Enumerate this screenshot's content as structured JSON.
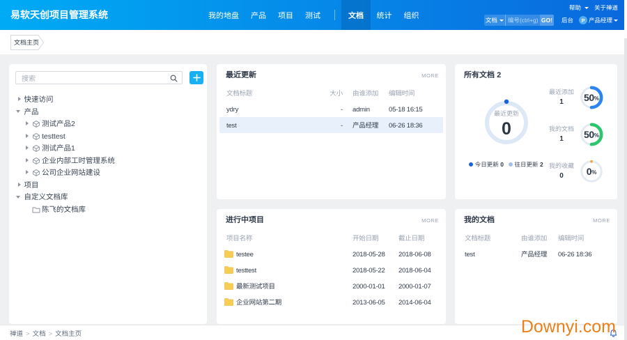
{
  "accent_colors": {
    "header_gradient_left": "#00abf5",
    "header_gradient_right": "#0a69dd",
    "highlight_row": "#e8f1fb",
    "watermark_color": "#e8811c"
  },
  "header": {
    "brand": "易软天创项目管理系统",
    "nav": [
      {
        "label": "我的地盘",
        "active": false
      },
      {
        "label": "产品",
        "active": false
      },
      {
        "label": "项目",
        "active": false
      },
      {
        "label": "测试",
        "active": false
      },
      {
        "label": "文档",
        "active": true
      },
      {
        "label": "统计",
        "active": false
      },
      {
        "label": "组织",
        "active": false
      }
    ],
    "help": "帮助",
    "about": "关于禅道",
    "search": {
      "module": "文档",
      "placeholder": "编号(ctrl+g)",
      "go": "GO!"
    },
    "admin": "后台",
    "avatar": "P",
    "user": "产品经理"
  },
  "tabs": [
    {
      "label": "文档主页",
      "active": true
    }
  ],
  "sidebar": {
    "search_placeholder": "搜索",
    "add_label": "+",
    "tree": [
      {
        "label": "快速访问",
        "state": "collapsed"
      },
      {
        "label": "产品",
        "state": "expanded"
      },
      {
        "label": "测试产品2",
        "parent": "产品",
        "icon": "product"
      },
      {
        "label": "testtest",
        "parent": "产品",
        "icon": "product"
      },
      {
        "label": "测试产品1",
        "parent": "产品",
        "icon": "product"
      },
      {
        "label": "企业内部工时管理系统",
        "parent": "产品",
        "icon": "product"
      },
      {
        "label": "公司企业网站建设",
        "parent": "产品",
        "icon": "product"
      },
      {
        "label": "项目",
        "state": "collapsed"
      },
      {
        "label": "自定义文档库",
        "state": "expanded"
      },
      {
        "label": "陈飞的文档库",
        "parent": "自定义文档库",
        "icon": "folder"
      }
    ]
  },
  "cards": {
    "recent": {
      "title": "最近更新",
      "more": "MORE",
      "columns": [
        "文档标题",
        "大小",
        "由谁添加",
        "编辑时间"
      ],
      "rows": [
        {
          "title": "ydry",
          "size": "-",
          "added_by": "admin",
          "edited": "05-18 16:15",
          "highlight": false
        },
        {
          "title": "test",
          "size": "-",
          "added_by": "产品经理",
          "edited": "06-26 18:36",
          "highlight": true
        }
      ]
    },
    "overview": {
      "title": "所有文档",
      "count": "2",
      "main_gauge": {
        "label": "最近更新",
        "value": "0"
      },
      "legend": [
        {
          "label": "今日更新",
          "value": "0",
          "color": "#1b62d6"
        },
        {
          "label": "往日更新",
          "value": "2",
          "color": "#a3c0ea"
        }
      ],
      "gauges": [
        {
          "label": "最近添加",
          "value": "1",
          "percent": 50,
          "unit": "%",
          "color": "#2b85ef"
        },
        {
          "label": "我的文档",
          "value": "1",
          "percent": 50,
          "unit": "%",
          "color": "#2bc56e"
        },
        {
          "label": "我的收藏",
          "value": "0",
          "percent": 0,
          "unit": "%",
          "color": "#f2a73d"
        }
      ]
    },
    "projects": {
      "title": "进行中项目",
      "more": "MORE",
      "columns": [
        "项目名称",
        "开始日期",
        "截止日期"
      ],
      "rows": [
        {
          "name": "testee",
          "begin": "2018-05-28",
          "end": "2018-06-08"
        },
        {
          "name": "testtest",
          "begin": "2018-05-22",
          "end": "2018-06-04"
        },
        {
          "name": "最新测试项目",
          "begin": "2000-01-01",
          "end": "2000-01-07"
        },
        {
          "name": "企业网站第二期",
          "begin": "2013-06-05",
          "end": "2014-06-04"
        }
      ]
    },
    "mydocs": {
      "title": "我的文档",
      "more": "MORE",
      "columns": [
        "文档标题",
        "由谁添加",
        "编辑时间"
      ],
      "rows": [
        {
          "title": "test",
          "added_by": "产品经理",
          "edited": "06-26 18:36"
        }
      ]
    }
  },
  "footer": {
    "breadcrumb": [
      "禅道",
      "文档",
      "文档主页"
    ]
  },
  "watermark": "Downyi.com",
  "chart_data": [
    {
      "type": "donut",
      "title": "最近更新",
      "value": 0,
      "legend": [
        {
          "label": "今日更新",
          "value": 0
        },
        {
          "label": "往日更新",
          "value": 2
        }
      ]
    },
    {
      "type": "gauge",
      "label": "最近添加",
      "value": 1,
      "percent": 50
    },
    {
      "type": "gauge",
      "label": "我的文档",
      "value": 1,
      "percent": 50
    },
    {
      "type": "gauge",
      "label": "我的收藏",
      "value": 0,
      "percent": 0
    }
  ]
}
